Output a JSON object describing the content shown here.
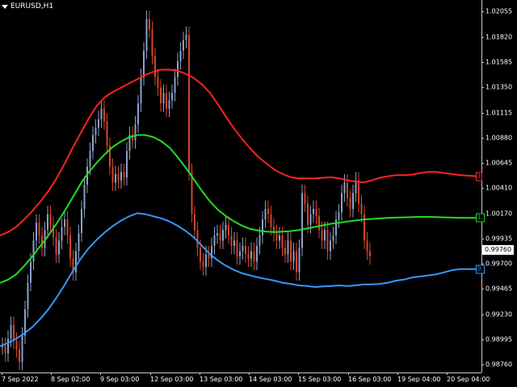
{
  "window": {
    "symbol_title": "EURUSD,H1"
  },
  "price_axis": {
    "labels": [
      "1.02055",
      "1.01820",
      "1.01585",
      "1.01350",
      "1.01115",
      "1.00880",
      "1.00645",
      "1.00410",
      "1.00170",
      "0.99935",
      "0.99700",
      "0.99465",
      "0.99230",
      "0.98995",
      "0.98760"
    ]
  },
  "time_axis": {
    "labels": [
      "7 Sep 2022",
      "8 Sep 02:00",
      "9 Sep 03:00",
      "12 Sep 03:00",
      "13 Sep 03:00",
      "14 Sep 03:00",
      "15 Sep 03:00",
      "16 Sep 03:00",
      "19 Sep 04:00",
      "20 Sep 04:00"
    ]
  },
  "current_price": "0.99760",
  "markers": {
    "upper": {
      "text": "1",
      "color": "#ff2a2a"
    },
    "middle": {
      "text": "1.",
      "color": "#22d322"
    },
    "lower": {
      "text": "0.",
      "color": "#3399ff"
    }
  },
  "colors": {
    "bull": "#8aa0c8",
    "bear": "#d2462a",
    "upper_band": "#ff2222",
    "middle_band": "#22dd22",
    "lower_band": "#3399ff"
  },
  "chart_data": {
    "type": "candlestick",
    "title": "EURUSD,H1",
    "ylim": [
      0.986,
      1.0213
    ],
    "series": [
      {
        "name": "upper band",
        "color": "#ff2222",
        "x": [
          0,
          10,
          20,
          30,
          40,
          50,
          60,
          70,
          80,
          90,
          100,
          110,
          120,
          130,
          140,
          150,
          160,
          170,
          180,
          190,
          200,
          210,
          220,
          230,
          240,
          250,
          260,
          270,
          280,
          290,
          300,
          310,
          320,
          330,
          340,
          350,
          360,
          370,
          380,
          390,
          400,
          410,
          420,
          430,
          440,
          450,
          460,
          470,
          480,
          490,
          500,
          510,
          520,
          530,
          540,
          550,
          560,
          570,
          580,
          590
        ],
        "values": [
          0.999,
          0.9993,
          0.9998,
          1.0005,
          1.0013,
          1.0022,
          1.0032,
          1.0044,
          1.0058,
          1.0073,
          1.0087,
          1.0101,
          1.0113,
          1.0121,
          1.0126,
          1.013,
          1.0134,
          1.0138,
          1.0142,
          1.0145,
          1.0147,
          1.0147,
          1.0146,
          1.0143,
          1.0139,
          1.0133,
          1.0125,
          1.0114,
          1.0102,
          1.0091,
          1.0081,
          1.0072,
          1.0064,
          1.0058,
          1.0052,
          1.0048,
          1.0045,
          1.0044,
          1.0044,
          1.0044,
          1.00445,
          1.0045,
          1.0044,
          1.0042,
          1.0041,
          1.004,
          1.0042,
          1.00445,
          1.0046,
          1.0047,
          1.0047,
          1.00475,
          1.0049,
          1.005,
          1.005,
          1.0049,
          1.0048,
          1.0047,
          1.00465,
          1.0046
        ]
      },
      {
        "name": "middle band",
        "color": "#22dd22",
        "x": [
          0,
          10,
          20,
          30,
          40,
          50,
          60,
          70,
          80,
          90,
          100,
          110,
          120,
          130,
          140,
          150,
          160,
          170,
          180,
          190,
          200,
          210,
          220,
          230,
          240,
          250,
          260,
          270,
          280,
          290,
          300,
          310,
          320,
          330,
          340,
          350,
          360,
          370,
          380,
          390,
          400,
          410,
          420,
          430,
          440,
          450,
          460,
          470,
          480,
          490,
          500,
          510,
          520,
          530,
          540,
          550,
          560,
          570,
          580,
          590
        ],
        "values": [
          0.9945,
          0.9948,
          0.9953,
          0.9961,
          0.997,
          0.998,
          0.999,
          1.0001,
          1.0013,
          1.0026,
          1.0039,
          1.005,
          1.0059,
          1.0067,
          1.0074,
          1.0079,
          1.0083,
          1.0085,
          1.0085,
          1.0083,
          1.0079,
          1.0073,
          1.0064,
          1.0054,
          1.0043,
          1.0032,
          1.0022,
          1.0014,
          1.0008,
          1.0003,
          0.9999,
          0.9996,
          0.99945,
          0.99935,
          0.9993,
          0.99935,
          0.9994,
          0.9995,
          0.99965,
          0.9998,
          0.99995,
          1.0001,
          1.0002,
          1.0003,
          1.0004,
          1.0005,
          1.00055,
          1.0006,
          1.00065,
          1.00068,
          1.0007,
          1.00072,
          1.00075,
          1.00075,
          1.00073,
          1.0007,
          1.00068,
          1.00066,
          1.00065,
          1.00064
        ]
      },
      {
        "name": "lower band",
        "color": "#3399ff",
        "x": [
          0,
          10,
          20,
          30,
          40,
          50,
          60,
          70,
          80,
          90,
          100,
          110,
          120,
          130,
          140,
          150,
          160,
          170,
          180,
          190,
          200,
          210,
          220,
          230,
          240,
          250,
          260,
          270,
          280,
          290,
          300,
          310,
          320,
          330,
          340,
          350,
          360,
          370,
          380,
          390,
          400,
          410,
          420,
          430,
          440,
          450,
          460,
          470,
          480,
          490,
          500,
          510,
          520,
          530,
          540,
          550,
          560,
          570,
          580,
          590
        ],
        "values": [
          0.9885,
          0.9888,
          0.9892,
          0.9897,
          0.9903,
          0.9911,
          0.992,
          0.9931,
          0.9943,
          0.9956,
          0.9968,
          0.9978,
          0.9986,
          0.9993,
          0.9999,
          1.0004,
          1.0008,
          1.0011,
          1.001,
          1.0008,
          1.0006,
          1.0003,
          0.9999,
          0.9994,
          0.9988,
          0.998,
          0.9972,
          0.9966,
          0.9961,
          0.9957,
          0.9954,
          0.9952,
          0.995,
          0.99485,
          0.9947,
          0.9945,
          0.9944,
          0.99425,
          0.9942,
          0.9941,
          0.99415,
          0.9942,
          0.99425,
          0.9942,
          0.99425,
          0.99435,
          0.99435,
          0.9944,
          0.9945,
          0.9947,
          0.9948,
          0.995,
          0.9951,
          0.9952,
          0.9953,
          0.9955,
          0.9957,
          0.9958,
          0.9958,
          0.9958
        ]
      }
    ],
    "candles": {
      "x_start": 2,
      "x_step": 3.5,
      "close": [
        0.9885,
        0.9878,
        0.9892,
        0.9905,
        0.989,
        0.9882,
        0.987,
        0.9895,
        0.992,
        0.9945,
        0.9965,
        0.9985,
        1.0002,
        0.999,
        0.9978,
        0.9995,
        1.001,
        1.0,
        0.9988,
        0.9972,
        0.9985,
        0.9998,
        1.0005,
        0.999,
        0.9968,
        0.9955,
        0.9975,
        0.9992,
        1.0015,
        1.0038,
        1.0055,
        1.007,
        1.0085,
        1.0092,
        1.01,
        1.011,
        1.0098,
        1.0075,
        1.0055,
        1.004,
        1.0048,
        1.0042,
        1.005,
        1.0045,
        1.007,
        1.0085,
        1.008,
        1.0095,
        1.0115,
        1.014,
        1.0165,
        1.0195,
        1.0185,
        1.016,
        1.014,
        1.013,
        1.0115,
        1.0125,
        1.011,
        1.0118,
        1.0125,
        1.014,
        1.0155,
        1.0165,
        1.0175,
        1.018,
        1.005,
        1.001,
        0.9995,
        0.9978,
        0.9965,
        0.996,
        0.9972,
        0.9968,
        0.998,
        0.999,
        0.9992,
        0.9985,
        0.9995,
        1.0,
        0.999,
        0.998,
        0.9985,
        0.997,
        0.9975,
        0.998,
        0.9972,
        0.9968,
        0.9975,
        0.9965,
        0.998,
        0.999,
        1.0005,
        1.0015,
        1.001,
        0.9998,
        0.9992,
        0.9985,
        0.999,
        0.9978,
        0.9972,
        0.9985,
        0.9965,
        0.9975,
        0.9955,
        0.9978,
        1.003,
        1.002,
        1.0,
        1.001,
        1.0015,
        1.0008,
        0.9995,
        0.9985,
        0.9995,
        0.9975,
        0.9985,
        0.999,
        1.0005,
        1.0012,
        1.003,
        1.004,
        1.0025,
        1.0015,
        1.003,
        1.0042,
        1.002,
        1.001,
        0.9985,
        0.9975,
        0.997
      ]
    }
  }
}
